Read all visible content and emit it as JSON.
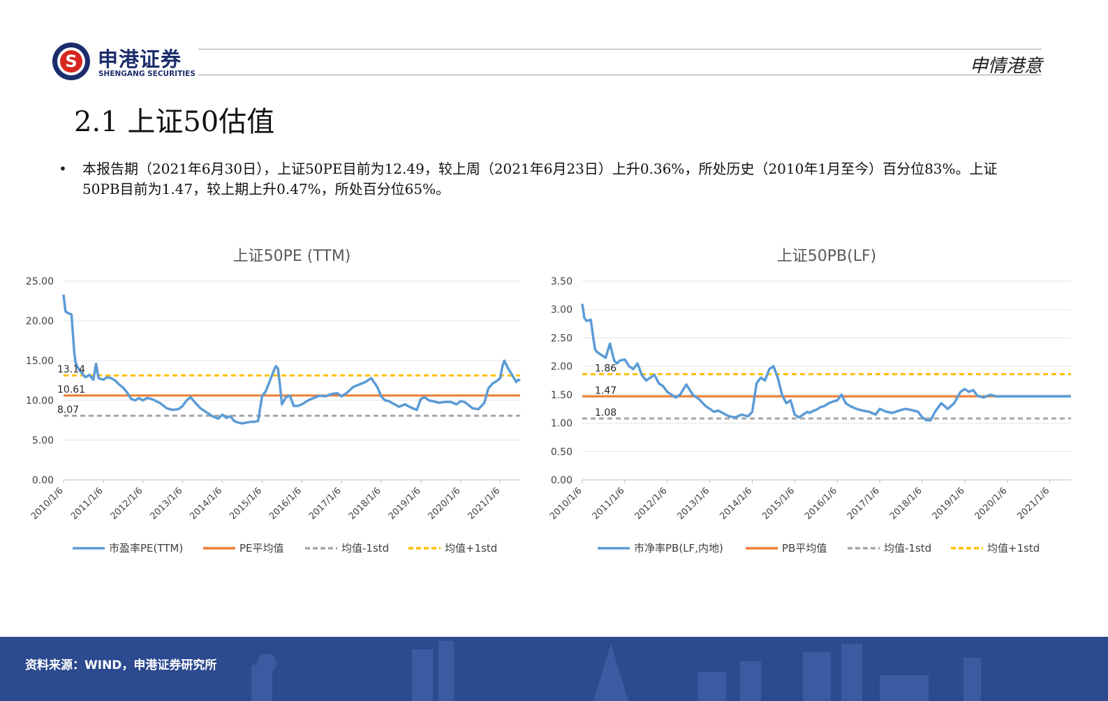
{
  "header": {
    "company_cn": "申港证券",
    "company_en": "SHENGANG SECURITIES",
    "slogan": "申情港意",
    "brand_color": "#1b2d6b",
    "accent_red": "#d7261e"
  },
  "title": "2.1 上证50估值",
  "bullet": "本报告期（2021年6月30日），上证50PE目前为12.49，较上周（2021年6月23日）上升0.36%，所处历史（2010年1月至今）百分位83%。上证50PB目前为1.47，较上期上升0.47%，所处百分位65%。",
  "footer": {
    "source": "资料来源：WIND，申港证券研究所",
    "background": "#2c4a8f"
  },
  "chart_data": [
    {
      "type": "line",
      "title": "上证50PE (TTM)",
      "ylim": [
        0,
        25
      ],
      "yticks": [
        "0.00",
        "5.00",
        "10.00",
        "15.00",
        "20.00",
        "25.00"
      ],
      "x_tick_labels": [
        "2010/1/6",
        "2011/1/6",
        "2012/1/6",
        "2013/1/6",
        "2014/1/6",
        "2015/1/6",
        "2016/1/6",
        "2017/1/6",
        "2018/1/6",
        "2019/1/6",
        "2020/1/6",
        "2021/1/6"
      ],
      "x_range": [
        2010.0,
        2021.5
      ],
      "grid": true,
      "legend_position": "bottom",
      "series": [
        {
          "name": "市盈率PE(TTM)",
          "color": "#5b9bd5",
          "x": [
            2010.0,
            2010.05,
            2010.1,
            2010.2,
            2010.27,
            2010.3,
            2010.35,
            2010.45,
            2010.55,
            2010.65,
            2010.75,
            2010.82,
            2010.88,
            2011.0,
            2011.1,
            2011.2,
            2011.3,
            2011.4,
            2011.5,
            2011.6,
            2011.7,
            2011.8,
            2011.9,
            2012.0,
            2012.1,
            2012.2,
            2012.3,
            2012.45,
            2012.6,
            2012.75,
            2012.9,
            2013.0,
            2013.1,
            2013.2,
            2013.3,
            2013.45,
            2013.6,
            2013.75,
            2013.9,
            2014.0,
            2014.1,
            2014.2,
            2014.3,
            2014.4,
            2014.5,
            2014.6,
            2014.7,
            2014.8,
            2014.9,
            2015.0,
            2015.1,
            2015.2,
            2015.3,
            2015.35,
            2015.4,
            2015.45,
            2015.5,
            2015.6,
            2015.7,
            2015.8,
            2015.9,
            2016.0,
            2016.1,
            2016.2,
            2016.3,
            2016.45,
            2016.6,
            2016.75,
            2016.9,
            2017.0,
            2017.15,
            2017.3,
            2017.45,
            2017.6,
            2017.75,
            2017.9,
            2018.0,
            2018.1,
            2018.2,
            2018.3,
            2018.45,
            2018.6,
            2018.75,
            2018.9,
            2019.0,
            2019.1,
            2019.2,
            2019.3,
            2019.45,
            2019.6,
            2019.75,
            2019.9,
            2020.0,
            2020.1,
            2020.2,
            2020.3,
            2020.45,
            2020.6,
            2020.7,
            2020.8,
            2020.9,
            2021.0,
            2021.05,
            2021.1,
            2021.15,
            2021.2,
            2021.3,
            2021.4,
            2021.45,
            2021.5
          ],
          "y": [
            23.3,
            21.2,
            21.0,
            20.8,
            16.0,
            14.8,
            14.2,
            13.5,
            12.9,
            13.2,
            12.6,
            14.6,
            12.8,
            12.6,
            12.9,
            12.8,
            12.5,
            12.0,
            11.6,
            11.0,
            10.2,
            10.0,
            10.3,
            10.0,
            10.3,
            10.2,
            10.0,
            9.6,
            9.0,
            8.8,
            8.9,
            9.3,
            10.0,
            10.4,
            9.8,
            9.0,
            8.5,
            8.0,
            7.7,
            8.2,
            7.8,
            8.0,
            7.4,
            7.2,
            7.1,
            7.2,
            7.3,
            7.3,
            7.4,
            10.5,
            11.2,
            12.5,
            13.8,
            14.3,
            14.0,
            12.0,
            9.5,
            10.4,
            10.6,
            9.3,
            9.3,
            9.5,
            9.8,
            10.1,
            10.3,
            10.6,
            10.5,
            10.8,
            10.9,
            10.5,
            11.0,
            11.7,
            12.0,
            12.3,
            12.8,
            11.7,
            10.5,
            10.0,
            9.9,
            9.6,
            9.2,
            9.5,
            9.1,
            8.8,
            10.2,
            10.4,
            10.0,
            9.9,
            9.7,
            9.8,
            9.8,
            9.5,
            9.9,
            9.8,
            9.4,
            9.0,
            8.9,
            9.7,
            11.5,
            12.1,
            12.4,
            12.8,
            14.2,
            15.0,
            14.5,
            14.0,
            13.2,
            12.3,
            12.6,
            12.49
          ]
        },
        {
          "name": "PE平均值",
          "color": "#ed7d31",
          "value": 10.61,
          "label": "10.61"
        },
        {
          "name": "均值-1std",
          "color": "#a5a5a5",
          "value": 8.07,
          "label": "8.07"
        },
        {
          "name": "均值+1std",
          "color": "#ffc000",
          "value": 13.14,
          "label": "13.14"
        }
      ]
    },
    {
      "type": "line",
      "title": "上证50PB(LF)",
      "ylim": [
        0,
        3.5
      ],
      "yticks": [
        "0.00",
        "0.50",
        "1.00",
        "1.50",
        "2.00",
        "2.50",
        "3.00",
        "3.50"
      ],
      "x_tick_labels": [
        "2010/1/6",
        "2011/1/6",
        "2012/1/6",
        "2013/1/6",
        "2014/1/6",
        "2015/1/6",
        "2016/1/6",
        "2017/1/6",
        "2018/1/6",
        "2019/1/6",
        "2020/1/6",
        "2021/1/6"
      ],
      "x_range": [
        2010.0,
        2021.5
      ],
      "grid": true,
      "legend_position": "bottom",
      "series": [
        {
          "name": "市净率PB(LF,内地)",
          "color": "#5b9bd5",
          "x": [
            2010.0,
            2010.05,
            2010.1,
            2010.2,
            2010.27,
            2010.3,
            2010.35,
            2010.45,
            2010.55,
            2010.65,
            2010.75,
            2010.82,
            2010.88,
            2011.0,
            2011.1,
            2011.2,
            2011.3,
            2011.4,
            2011.5,
            2011.6,
            2011.7,
            2011.8,
            2011.9,
            2012.0,
            2012.1,
            2012.2,
            2012.3,
            2012.45,
            2012.6,
            2012.75,
            2012.9,
            2013.0,
            2013.1,
            2013.2,
            2013.3,
            2013.45,
            2013.6,
            2013.75,
            2013.9,
            2014.0,
            2014.1,
            2014.2,
            2014.3,
            2014.4,
            2014.5,
            2014.6,
            2014.7,
            2014.8,
            2014.9,
            2015.0,
            2015.1,
            2015.2,
            2015.3,
            2015.35,
            2015.4,
            2015.45,
            2015.5,
            2015.6,
            2015.7,
            2015.8,
            2015.9,
            2016.0,
            2016.1,
            2016.2,
            2016.3,
            2016.45,
            2016.6,
            2016.75,
            2016.9,
            2017.0,
            2017.15,
            2017.3,
            2017.45,
            2017.6,
            2017.75,
            2017.9,
            2018.0,
            2018.1,
            2018.2,
            2018.3,
            2018.45,
            2018.6,
            2018.75,
            2018.9,
            2019.0,
            2019.1,
            2019.2,
            2019.3,
            2019.45,
            2019.6,
            2019.75,
            2019.9,
            2020.0,
            2020.1,
            2020.2,
            2020.3,
            2020.45,
            2020.6,
            2020.7,
            2020.8,
            2020.9,
            2021.0,
            2021.05,
            2021.1,
            2021.15,
            2021.2,
            2021.3,
            2021.4,
            2021.45,
            2021.5
          ],
          "y": [
            3.1,
            2.85,
            2.8,
            2.82,
            2.45,
            2.3,
            2.25,
            2.2,
            2.15,
            2.4,
            2.1,
            2.05,
            2.1,
            2.12,
            2.0,
            1.95,
            2.05,
            1.85,
            1.75,
            1.8,
            1.85,
            1.7,
            1.65,
            1.55,
            1.5,
            1.45,
            1.5,
            1.68,
            1.5,
            1.42,
            1.3,
            1.25,
            1.2,
            1.22,
            1.18,
            1.12,
            1.1,
            1.15,
            1.12,
            1.2,
            1.7,
            1.8,
            1.75,
            1.95,
            2.0,
            1.8,
            1.5,
            1.35,
            1.4,
            1.15,
            1.1,
            1.15,
            1.2,
            1.18,
            1.2,
            1.22,
            1.23,
            1.28,
            1.3,
            1.35,
            1.38,
            1.4,
            1.5,
            1.35,
            1.3,
            1.25,
            1.22,
            1.2,
            1.15,
            1.25,
            1.2,
            1.18,
            1.22,
            1.25,
            1.23,
            1.2,
            1.1,
            1.05,
            1.05,
            1.2,
            1.35,
            1.25,
            1.35,
            1.55,
            1.6,
            1.55,
            1.58,
            1.48,
            1.45,
            1.5,
            1.47,
            1.47,
            1.47,
            1.47,
            1.47,
            1.47,
            1.47,
            1.47,
            1.47,
            1.47,
            1.47,
            1.47,
            1.47,
            1.47,
            1.47,
            1.47,
            1.47,
            1.47,
            1.47,
            1.47
          ]
        },
        {
          "name": "PB平均值",
          "color": "#ed7d31",
          "value": 1.47,
          "label": "1.47"
        },
        {
          "name": "均值-1std",
          "color": "#a5a5a5",
          "value": 1.08,
          "label": "1.08"
        },
        {
          "name": "均值+1std",
          "color": "#ffc000",
          "value": 1.86,
          "label": "1.86"
        }
      ]
    }
  ]
}
